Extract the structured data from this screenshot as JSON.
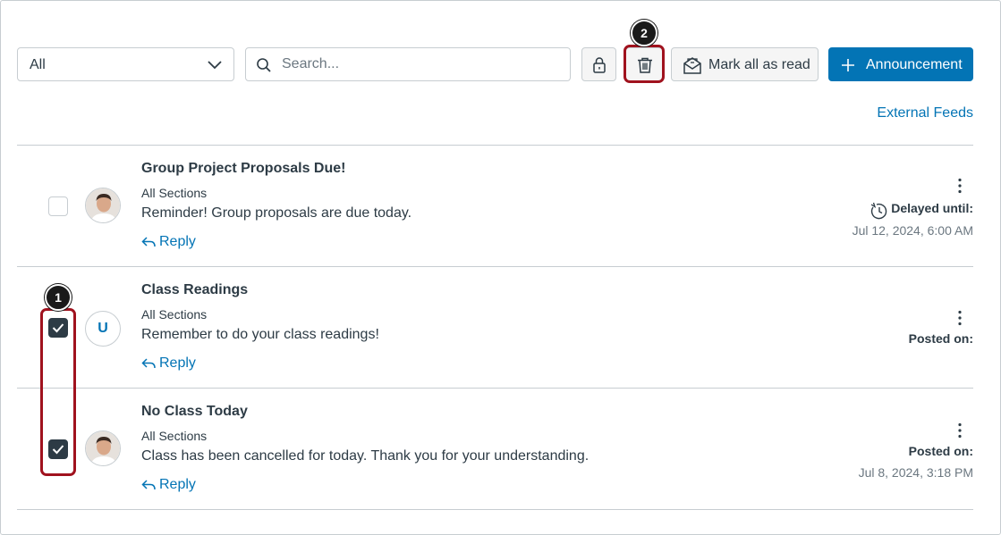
{
  "toolbar": {
    "filter_value": "All",
    "search_placeholder": "Search...",
    "mark_all_read_label": "Mark all as read",
    "announcement_label": "Announcement",
    "external_feeds_label": "External Feeds"
  },
  "callouts": {
    "one": "1",
    "two": "2"
  },
  "announcements": [
    {
      "title": "Group Project Proposals Due!",
      "sections": "All Sections",
      "message": "Reminder! Group proposals are due today.",
      "reply_label": "Reply",
      "checked": false,
      "avatar": "photo",
      "status_label": "Delayed until:",
      "status_date": "Jul 12, 2024, 6:00 AM"
    },
    {
      "title": "Class Readings",
      "sections": "All Sections",
      "message": "Remember to do your class readings!",
      "reply_label": "Reply",
      "checked": true,
      "avatar": "U",
      "status_label": "Posted on:",
      "status_date": ""
    },
    {
      "title": "No Class Today",
      "sections": "All Sections",
      "message": "Class has been cancelled for today. Thank you for your understanding.",
      "reply_label": "Reply",
      "checked": true,
      "avatar": "photo",
      "status_label": "Posted on:",
      "status_date": "Jul 8, 2024, 3:18 PM"
    }
  ],
  "colors": {
    "brand_blue": "#0374b5",
    "highlight_red": "#a0121e",
    "text_dark": "#2d3b45"
  }
}
